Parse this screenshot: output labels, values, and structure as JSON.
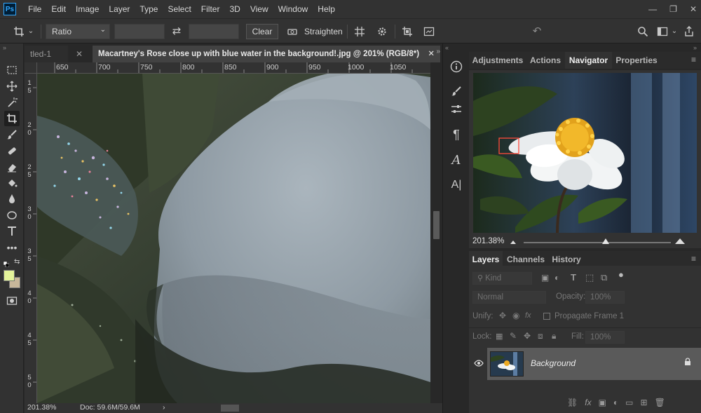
{
  "app": {
    "logo": "Ps"
  },
  "menu": [
    "File",
    "Edit",
    "Image",
    "Layer",
    "Type",
    "Select",
    "Filter",
    "3D",
    "View",
    "Window",
    "Help"
  ],
  "window_controls": {
    "minimize": "—",
    "restore": "❐",
    "close": "✕"
  },
  "options": {
    "ratio_label": "Ratio",
    "ratio_dropdown": "⌄",
    "swap_icon": "⇄",
    "clear_label": "Clear",
    "straighten_label": "Straighten",
    "reset_icon": "↶"
  },
  "document": {
    "inactive_tab": "tled-1",
    "inactive_tab_close": "✕",
    "active_tab": "Macartney's Rose close up with blue water in the background!.jpg @ 201% (RGB/8*)",
    "active_tab_close": "✕",
    "ruler_top_ticks": [
      "650",
      "700",
      "750",
      "800",
      "850",
      "900",
      "950",
      "1000",
      "1050"
    ],
    "ruler_left_ticks": [
      "1",
      "5",
      "2",
      "0",
      "2",
      "5",
      "3",
      "0",
      "3",
      "5",
      "4",
      "0",
      "4",
      "5",
      "5",
      "0"
    ]
  },
  "status": {
    "zoom": "201.38%",
    "doc": "Doc: 59.6M/59.6M",
    "arrow": "›"
  },
  "panels": {
    "top_tabs": [
      "Adjustments",
      "Actions",
      "Navigator",
      "Properties"
    ],
    "active_top_tab": "Navigator",
    "navigator_zoom": "201.38%",
    "layers_tabs": [
      "Layers",
      "Channels",
      "History"
    ],
    "active_layers_tab": "Layers",
    "kind_label": "Kind",
    "blend_mode": "Normal",
    "opacity_label": "Opacity:",
    "opacity_value": "100%",
    "unify_label": "Unify:",
    "propagate_label": "Propagate Frame 1",
    "lock_label": "Lock:",
    "fill_label": "Fill:",
    "fill_value": "100%",
    "layer_name": "Background"
  },
  "colors": {
    "foreground": "#e4f39a",
    "background": "#c8b79a",
    "accent": "#31a8ff"
  }
}
